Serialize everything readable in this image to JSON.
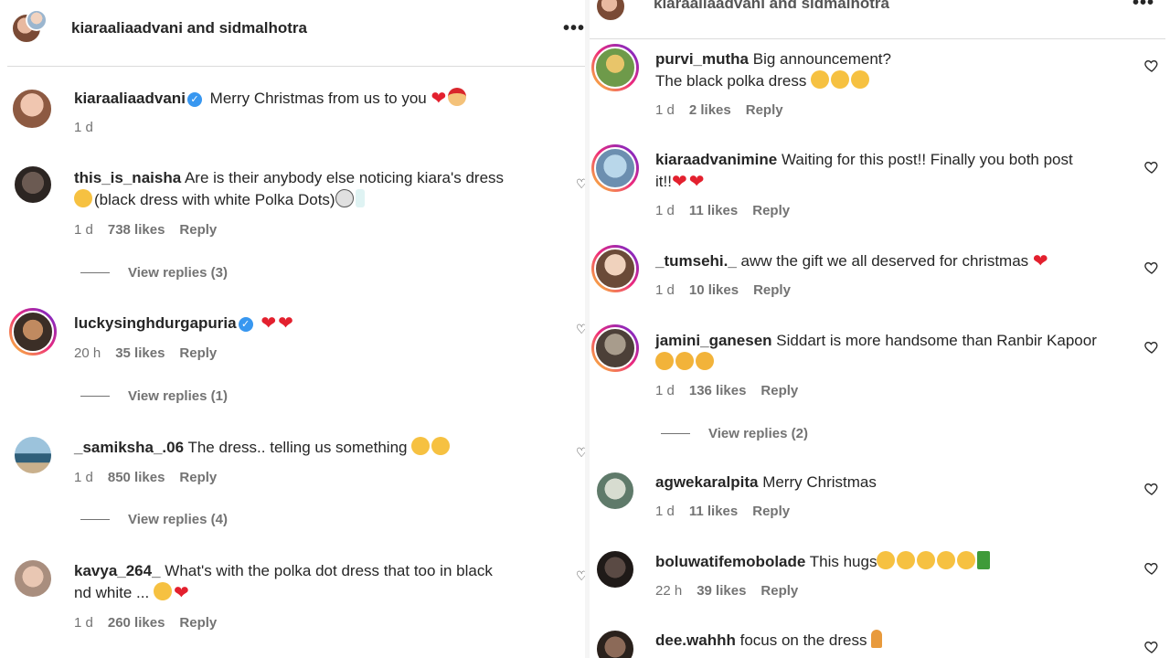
{
  "left": {
    "header": {
      "title": "kiaraaliaadvani and sidmalhotra",
      "more": "•••"
    },
    "caption": {
      "user": "kiaraaliaadvani",
      "text": "Merry Christmas from us to you",
      "time": "1 d"
    },
    "comments": [
      {
        "user": "this_is_naisha",
        "text_line1": "Are is their anybody else noticing kiara's dress",
        "text_line2": "(black dress with white Polka Dots)",
        "time": "1 d",
        "likes": "738 likes",
        "reply": "Reply",
        "view_replies": "View replies (3)"
      },
      {
        "user": "luckysinghdurgapuria",
        "text_line1": "",
        "time": "20 h",
        "likes": "35 likes",
        "reply": "Reply",
        "view_replies": "View replies (1)"
      },
      {
        "user": "_samiksha_.06",
        "text_line1": "The dress.. telling us something",
        "time": "1 d",
        "likes": "850 likes",
        "reply": "Reply",
        "view_replies": "View replies (4)"
      },
      {
        "user": "kavya_264_",
        "text_line1": "What's with the polka dot dress that too in black",
        "text_line2": "nd white ...",
        "time": "1 d",
        "likes": "260 likes",
        "reply": "Reply"
      }
    ]
  },
  "right": {
    "header": {
      "title": "kiaraaliaadvani and sidmalhotra",
      "more": "•••"
    },
    "comments": [
      {
        "user": "purvi_mutha",
        "text_line1": "Big announcement?",
        "text_line2": "The black polka dress",
        "time": "1 d",
        "likes": "2 likes",
        "reply": "Reply"
      },
      {
        "user": "kiaraadvanimine",
        "text_line1": "Waiting for this post!! Finally you both post",
        "text_line2": "it!!",
        "time": "1 d",
        "likes": "11 likes",
        "reply": "Reply"
      },
      {
        "user": "_tumsehi._",
        "text_line1": "aww the gift we all deserved for christmas",
        "time": "1 d",
        "likes": "10 likes",
        "reply": "Reply"
      },
      {
        "user": "jamini_ganesen",
        "text_line1": "Siddart is more handsome than Ranbir Kapoor",
        "time": "1 d",
        "likes": "136 likes",
        "reply": "Reply",
        "view_replies": "View replies (2)"
      },
      {
        "user": "agwekaralpita",
        "text_line1": "Merry Christmas",
        "time": "1 d",
        "likes": "11 likes",
        "reply": "Reply"
      },
      {
        "user": "boluwatifemobolade",
        "text_line1": "This hugs",
        "time": "22 h",
        "likes": "39 likes",
        "reply": "Reply"
      },
      {
        "user": "dee.wahhh",
        "text_line1": "focus on the dress"
      }
    ]
  },
  "colors": {
    "text": "#262626",
    "muted": "#737373",
    "verified": "#3897f0",
    "heart": "#e3202e",
    "divider": "#dbdbdb"
  },
  "icons": {
    "like": "heart-outline-icon",
    "verified": "verified-badge-icon",
    "more": "more-dots-icon"
  }
}
